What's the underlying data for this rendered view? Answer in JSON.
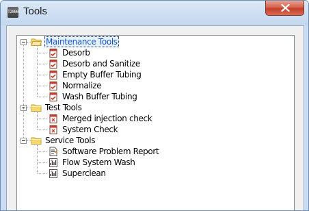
{
  "window": {
    "title": "Tools",
    "app_icon_text": "T2000",
    "close_icon": "close-icon"
  },
  "tree": {
    "groups": [
      {
        "label": "Maintenance Tools",
        "expanded": true,
        "selected": true,
        "items": [
          {
            "label": "Desorb",
            "icon": "maintenance-script-icon"
          },
          {
            "label": "Desorb and Sanitize",
            "icon": "maintenance-script-icon"
          },
          {
            "label": "Empty Buffer Tubing",
            "icon": "maintenance-script-icon"
          },
          {
            "label": "Normalize",
            "icon": "maintenance-script-icon"
          },
          {
            "label": "Wash Buffer Tubing",
            "icon": "maintenance-script-icon"
          }
        ]
      },
      {
        "label": "Test Tools",
        "expanded": true,
        "selected": false,
        "items": [
          {
            "label": "Merged injection check",
            "icon": "test-script-icon"
          },
          {
            "label": "System Check",
            "icon": "test-script-icon"
          }
        ]
      },
      {
        "label": "Service Tools",
        "expanded": true,
        "selected": false,
        "items": [
          {
            "label": "Software Problem Report",
            "icon": "report-document-icon"
          },
          {
            "label": "Flow System Wash",
            "icon": "service-chart-icon"
          },
          {
            "label": "Superclean",
            "icon": "service-chart-icon"
          }
        ]
      }
    ]
  },
  "colors": {
    "selection_border": "#0a2f7a",
    "selection_text": "#1155cc",
    "folder": "#f5d66b",
    "close_button": "#c4402a"
  }
}
